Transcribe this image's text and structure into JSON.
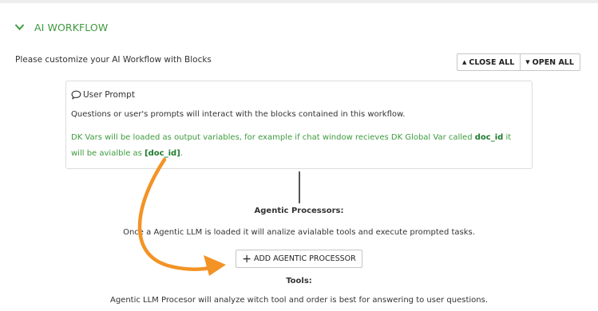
{
  "section": {
    "title": "AI WORKFLOW",
    "accent_color": "#3e9a3e",
    "toggle_icon": "chevron-down-icon"
  },
  "intro_text": "Please customize your AI Workflow with Blocks",
  "toolbar": {
    "close_all_label": "CLOSE ALL",
    "open_all_label": "OPEN ALL",
    "close_all_icon": "caret-up-icon",
    "open_all_icon": "caret-down-icon"
  },
  "user_prompt": {
    "title": "User Prompt",
    "icon": "chat-bubble-icon",
    "description": "Questions or user's prompts will interact with the blocks contained in this workflow.",
    "vars_note_pre": "DK Vars will be loaded as output variables, for example if chat window recieves DK Global Var called ",
    "vars_note_var": "doc_id",
    "vars_note_mid": " it will be avialble as ",
    "vars_note_token": "[doc_id]",
    "vars_note_end": "."
  },
  "agentic": {
    "heading": "Agentic Processors:",
    "description": "Once a Agentic LLM is loaded it will analize avialable tools and execute prompted tasks.",
    "add_button_label": "ADD AGENTIC PROCESSOR",
    "add_icon": "plus-icon"
  },
  "tools": {
    "heading": "Tools:",
    "description": "Agentic LLM Procesor will analyze witch tool and order is best for answering to user questions."
  },
  "annotation": {
    "arrow_color": "#f39325"
  }
}
